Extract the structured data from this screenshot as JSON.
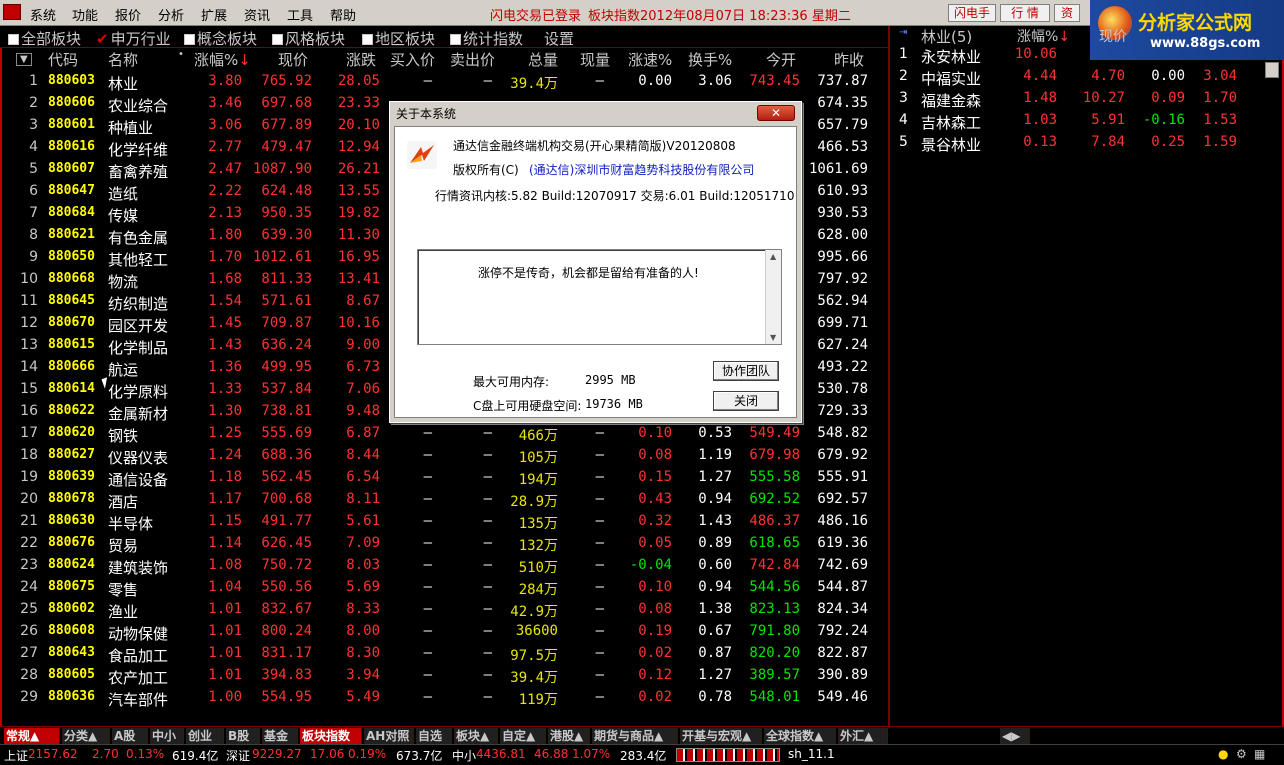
{
  "menu": {
    "items": [
      "系统",
      "功能",
      "报价",
      "分析",
      "扩展",
      "资讯",
      "工具",
      "帮助"
    ],
    "status": "闪电交易已登录",
    "title_info": "板块指数2012年08月07日  18:23:36  星期二",
    "buttons": [
      "闪电手",
      "行  情",
      "资"
    ]
  },
  "logo": {
    "text": "分析家公式网",
    "url": "www.88gs.com"
  },
  "tabs": [
    {
      "label": "全部板块",
      "checked": false
    },
    {
      "label": "申万行业",
      "checked": true
    },
    {
      "label": "概念板块",
      "checked": false
    },
    {
      "label": "风格板块",
      "checked": false
    },
    {
      "label": "地区板块",
      "checked": false
    },
    {
      "label": "统计指数",
      "checked": false
    },
    {
      "label": "设置",
      "checked": null
    }
  ],
  "table": {
    "headers": [
      "代码",
      "名称",
      "•",
      "涨幅%",
      "现价",
      "涨跌",
      "买入价",
      "卖出价",
      "总量",
      "现量",
      "涨速%",
      "换手%",
      "今开",
      "昨收"
    ],
    "sort_marker": "▼",
    "rows": [
      [
        "1",
        "880603",
        "林业",
        "3.80",
        "765.92",
        "28.05",
        "–",
        "–",
        "39.4万",
        "–",
        "0.00",
        "3.06",
        "743.45",
        "737.87"
      ],
      [
        "2",
        "880606",
        "农业综合",
        "3.46",
        "697.68",
        "23.33",
        "",
        "",
        "",
        "",
        "",
        "",
        "",
        "674.35"
      ],
      [
        "3",
        "880601",
        "种植业",
        "3.06",
        "677.89",
        "20.10",
        "",
        "",
        "",
        "",
        "",
        "",
        "",
        "657.79"
      ],
      [
        "4",
        "880616",
        "化学纤维",
        "2.77",
        "479.47",
        "12.94",
        "",
        "",
        "",
        "",
        "",
        "",
        "",
        "466.53"
      ],
      [
        "5",
        "880607",
        "畜禽养殖",
        "2.47",
        "1087.90",
        "26.21",
        "",
        "",
        "",
        "",
        "",
        "",
        "",
        "1061.69"
      ],
      [
        "6",
        "880647",
        "造纸",
        "2.22",
        "624.48",
        "13.55",
        "",
        "",
        "",
        "",
        "",
        "",
        "",
        "610.93"
      ],
      [
        "7",
        "880684",
        "传媒",
        "2.13",
        "950.35",
        "19.82",
        "",
        "",
        "",
        "",
        "",
        "",
        "",
        "930.53"
      ],
      [
        "8",
        "880621",
        "有色金属",
        "1.80",
        "639.30",
        "11.30",
        "",
        "",
        "",
        "",
        "",
        "",
        "",
        "628.00"
      ],
      [
        "9",
        "880650",
        "其他轻工",
        "1.70",
        "1012.61",
        "16.95",
        "",
        "",
        "",
        "",
        "",
        "",
        "",
        "995.66"
      ],
      [
        "10",
        "880668",
        "物流",
        "1.68",
        "811.33",
        "13.41",
        "",
        "",
        "",
        "",
        "",
        "",
        "",
        "797.92"
      ],
      [
        "11",
        "880645",
        "纺织制造",
        "1.54",
        "571.61",
        "8.67",
        "",
        "",
        "",
        "",
        "",
        "",
        "",
        "562.94"
      ],
      [
        "12",
        "880670",
        "园区开发",
        "1.45",
        "709.87",
        "10.16",
        "",
        "",
        "",
        "",
        "",
        "",
        "",
        "699.71"
      ],
      [
        "13",
        "880615",
        "化学制品",
        "1.43",
        "636.24",
        "9.00",
        "",
        "",
        "",
        "",
        "",
        "",
        "",
        "627.24"
      ],
      [
        "14",
        "880666",
        "航运",
        "1.36",
        "499.95",
        "6.73",
        "",
        "",
        "",
        "",
        "",
        "",
        "",
        "493.22"
      ],
      [
        "15",
        "880614",
        "化学原料",
        "1.33",
        "537.84",
        "7.06",
        "",
        "",
        "",
        "",
        "",
        "",
        "",
        "530.78"
      ],
      [
        "16",
        "880622",
        "金属新材",
        "1.30",
        "738.81",
        "9.48",
        "",
        "",
        "",
        "",
        "",
        "",
        "",
        "729.33"
      ],
      [
        "17",
        "880620",
        "钢铁",
        "1.25",
        "555.69",
        "6.87",
        "–",
        "–",
        "466万",
        "–",
        "0.10",
        "0.53",
        "549.49",
        "548.82"
      ],
      [
        "18",
        "880627",
        "仪器仪表",
        "1.24",
        "688.36",
        "8.44",
        "–",
        "–",
        "105万",
        "–",
        "0.08",
        "1.19",
        "679.98",
        "679.92"
      ],
      [
        "19",
        "880639",
        "通信设备",
        "1.18",
        "562.45",
        "6.54",
        "–",
        "–",
        "194万",
        "–",
        "0.15",
        "1.27",
        "555.58",
        "555.91"
      ],
      [
        "20",
        "880678",
        "酒店",
        "1.17",
        "700.68",
        "8.11",
        "–",
        "–",
        "28.9万",
        "–",
        "0.43",
        "0.94",
        "692.52",
        "692.57"
      ],
      [
        "21",
        "880630",
        "半导体",
        "1.15",
        "491.77",
        "5.61",
        "–",
        "–",
        "135万",
        "–",
        "0.32",
        "1.43",
        "486.37",
        "486.16"
      ],
      [
        "22",
        "880676",
        "贸易",
        "1.14",
        "626.45",
        "7.09",
        "–",
        "–",
        "132万",
        "–",
        "0.05",
        "0.89",
        "618.65",
        "619.36"
      ],
      [
        "23",
        "880624",
        "建筑装饰",
        "1.08",
        "750.72",
        "8.03",
        "–",
        "–",
        "510万",
        "–",
        "-0.04",
        "0.60",
        "742.84",
        "742.69"
      ],
      [
        "24",
        "880675",
        "零售",
        "1.04",
        "550.56",
        "5.69",
        "–",
        "–",
        "284万",
        "–",
        "0.10",
        "0.94",
        "544.56",
        "544.87"
      ],
      [
        "25",
        "880602",
        "渔业",
        "1.01",
        "832.67",
        "8.33",
        "–",
        "–",
        "42.9万",
        "–",
        "0.08",
        "1.38",
        "823.13",
        "824.34"
      ],
      [
        "26",
        "880608",
        "动物保健",
        "1.01",
        "800.24",
        "8.00",
        "–",
        "–",
        "36600",
        "–",
        "0.19",
        "0.67",
        "791.80",
        "792.24"
      ],
      [
        "27",
        "880643",
        "食品加工",
        "1.01",
        "831.17",
        "8.30",
        "–",
        "–",
        "97.5万",
        "–",
        "0.02",
        "0.87",
        "820.20",
        "822.87"
      ],
      [
        "28",
        "880605",
        "农产加工",
        "1.01",
        "394.83",
        "3.94",
        "–",
        "–",
        "39.4万",
        "–",
        "0.12",
        "1.27",
        "389.57",
        "390.89"
      ],
      [
        "29",
        "880636",
        "汽车部件",
        "1.00",
        "554.95",
        "5.49",
        "–",
        "–",
        "119万",
        "–",
        "0.02",
        "0.78",
        "548.01",
        "549.46"
      ]
    ]
  },
  "right_panel": {
    "title": "林业(5)",
    "headers": [
      "涨幅%",
      "现价"
    ],
    "rows": [
      [
        "1",
        "永安林业",
        "10.06",
        "",
        "",
        ""
      ],
      [
        "2",
        "中福实业",
        "4.44",
        "4.70",
        "0.00",
        "3.04"
      ],
      [
        "3",
        "福建金森",
        "1.48",
        "10.27",
        "0.09",
        "1.70"
      ],
      [
        "4",
        "吉林森工",
        "1.03",
        "5.91",
        "-0.16",
        "1.53"
      ],
      [
        "5",
        "景谷林业",
        "0.13",
        "7.84",
        "0.25",
        "1.59"
      ]
    ]
  },
  "dialog": {
    "title": "关于本系统",
    "product": "通达信金融终端机构交易(开心果精简版)V20120808",
    "copyright_label": "版权所有(C)",
    "copyright_company": "(通达信)深圳市财富趋势科技股份有限公司",
    "version_info": "行情资讯内核:5.82 Build:12070917 交易:6.01 Build:12051710",
    "message": "涨停不是传奇，机会都是留给有准备的人!",
    "mem_label": "最大可用内存:",
    "mem_value": "2995 MB",
    "disk_label": "C盘上可用硬盘空间:",
    "disk_value": "19736 MB",
    "team_button": "协作团队",
    "close_button": "关闭"
  },
  "bottom_tabs": [
    "常规▲",
    "分类▲",
    "A股",
    "中小",
    "创业",
    "B股",
    "基金",
    "板块指数",
    "AH对照",
    "自选",
    "板块▲",
    "自定▲",
    "港股▲",
    "期货与商品▲",
    "开基与宏观▲",
    "全球指数▲",
    "外汇▲"
  ],
  "status": {
    "sh_label": "上证",
    "sh_value": "2157.62",
    "sh_change": "2.70",
    "sh_pct": "0.13%",
    "sh_vol": "619.4亿",
    "sz_label": "深证",
    "sz_value": "9229.27",
    "sz_change": "17.06",
    "sz_pct": "0.19%",
    "sz_vol": "673.7亿",
    "zx_label": "中小",
    "zx_value": "4436.81",
    "zx_change": "46.88",
    "zx_pct": "1.07%",
    "zx_vol": "283.4亿",
    "code": "sh_11.1"
  },
  "colors": {
    "up": "#ff3232",
    "down": "#00e600",
    "code": "#ffff00",
    "frame": "#c00000"
  }
}
